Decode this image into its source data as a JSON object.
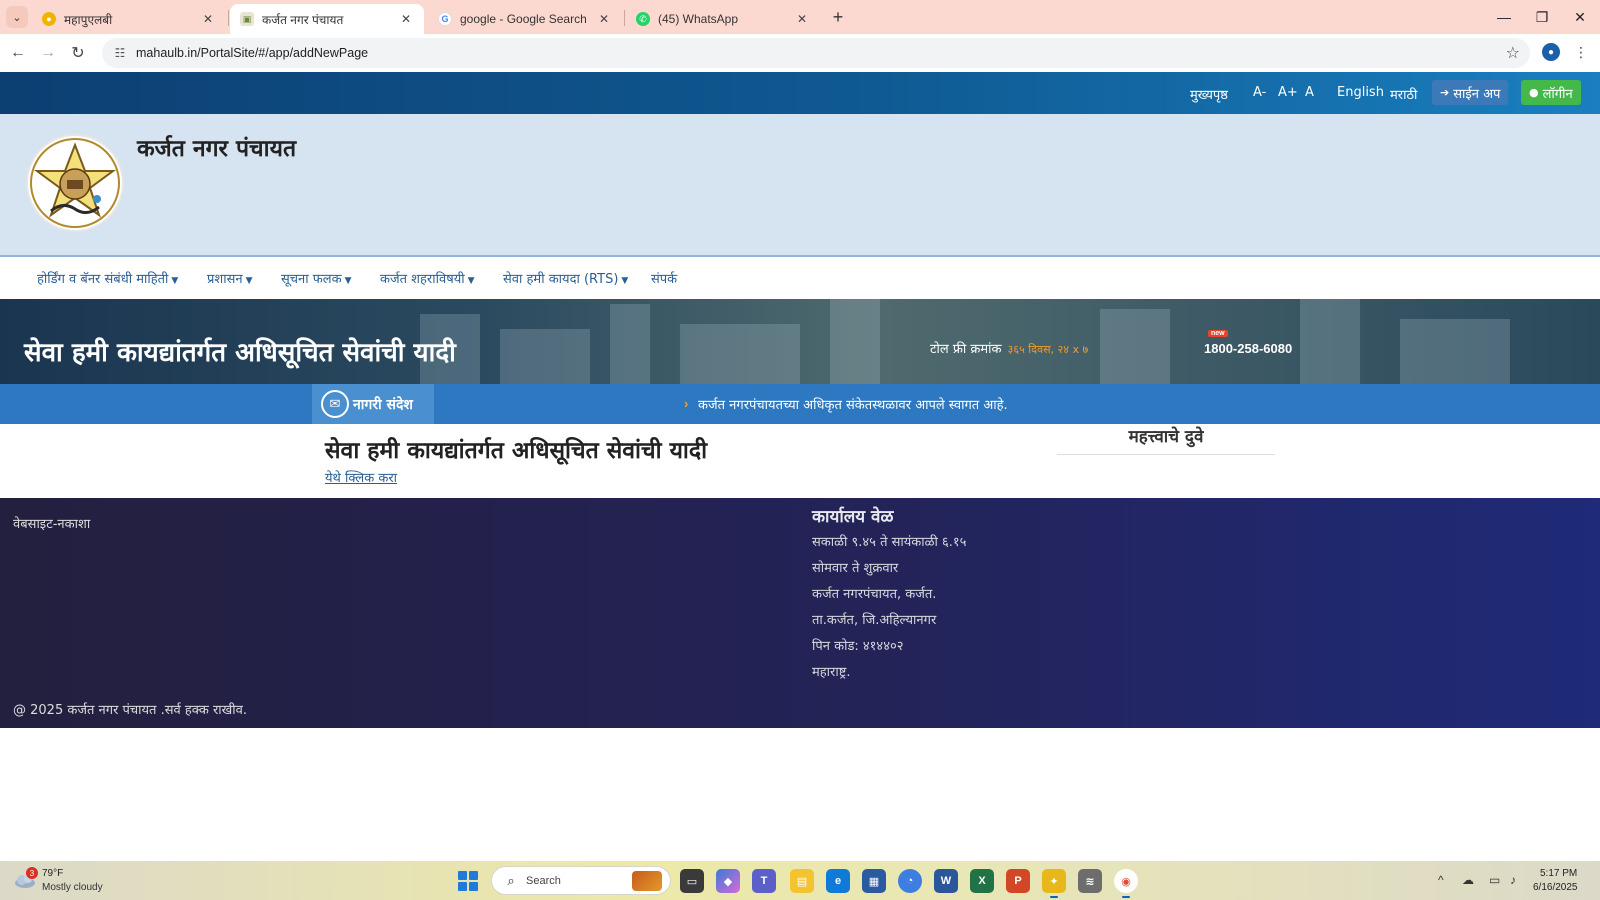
{
  "browser": {
    "tabs": [
      {
        "title": "महापुएलबी",
        "favicon_color": "#f0b400",
        "active": false
      },
      {
        "title": "कर्जत नगर पंचायत",
        "favicon_color": "#6a8a3a",
        "active": true
      },
      {
        "title": "google - Google Search",
        "favicon_color": "#4285f4",
        "active": false
      },
      {
        "title": "(45) WhatsApp",
        "favicon_color": "#25d366",
        "active": false
      }
    ],
    "url": "mahaulb.in/PortalSite/#/app/addNewPage"
  },
  "topbar": {
    "home": "मुख्यपृष्ठ",
    "font_smaller": "A-",
    "font_larger": "A+",
    "font_normal": "A",
    "lang_english": "English",
    "lang_marathi": "मराठी",
    "signup": "साईन अप",
    "login": "लॉगीन"
  },
  "header": {
    "site_title": "कर्जत नगर पंचायत"
  },
  "nav": {
    "items": [
      {
        "label": "होर्डिंग व बॅनर संबंधी माहिती",
        "dropdown": true
      },
      {
        "label": "प्रशासन",
        "dropdown": true
      },
      {
        "label": "सूचना फलक",
        "dropdown": true
      },
      {
        "label": "कर्जत शहराविषयी",
        "dropdown": true
      },
      {
        "label": "सेवा हमी कायदा (RTS)",
        "dropdown": true
      },
      {
        "label": "संपर्क",
        "dropdown": false
      }
    ]
  },
  "banner": {
    "title": "सेवा हमी कायद्यांतर्गत अधिसूचित सेवांची यादी",
    "tollfree_label": "टोल फ्री क्रमांक",
    "tollfree_hours": "३६५ दिवस, २४ x ७",
    "new_badge": "new",
    "tollfree_number": "1800-258-6080"
  },
  "newsbar": {
    "label": "नागरी संदेश",
    "message": "कर्जत नगरपंचायतच्या अधिकृत संकेतस्थळावर आपले स्वागत आहे."
  },
  "content": {
    "heading": "सेवा हमी कायद्यांतर्गत अधिसूचित सेवांची यादी",
    "link": "येथे क्लिक करा",
    "side_heading": "महत्त्वाचे दुवे"
  },
  "footer": {
    "sitemap": "वेबसाइट-नकाशा",
    "office_heading": "कार्यालय वेळ",
    "office_lines": [
      "सकाळी ९.४५ ते सायंकाळी ६.१५",
      "सोमवार ते शुक्रवार",
      "कर्जत नगरपंचायत, कर्जत.",
      "ता.कर्जत, जि.अहिल्यानगर",
      "पिन कोड: ४१४४०२",
      "महाराष्ट्र."
    ],
    "copyright": "@ 2025 कर्जत नगर पंचायत .सर्व हक्क राखीव."
  },
  "taskbar": {
    "weather_badge": "3",
    "weather_temp": "79°F",
    "weather_cond": "Mostly cloudy",
    "search_text": "Search",
    "time": "5:17 PM",
    "date": "6/16/2025"
  },
  "colors": {
    "topbar": "#0f5a93",
    "header_bg": "#d6e4f2",
    "newsbar": "#2d78c0",
    "footer": "#232358",
    "login": "#44b94a",
    "signup": "#3b79b8"
  }
}
